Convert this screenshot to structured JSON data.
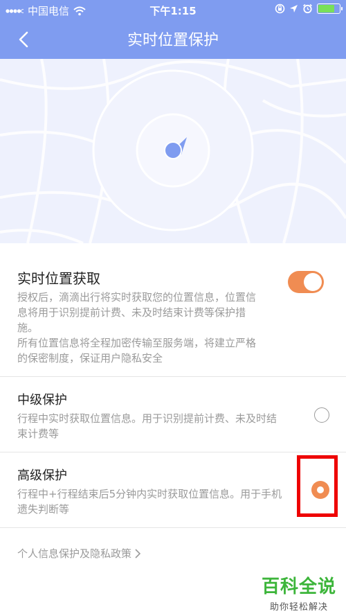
{
  "status_bar": {
    "carrier": "中国电信",
    "time": "下午1:15",
    "battery_level": 0.8,
    "icons": [
      "signal-icon",
      "wifi-icon",
      "rotation-lock-icon",
      "location-arrow-icon",
      "alarm-icon",
      "battery-icon"
    ]
  },
  "nav": {
    "title": "实时位置保护",
    "back_icon": "chevron-left-icon"
  },
  "realtime_location": {
    "title": "实时位置获取",
    "desc_lines": [
      "授权后，滴滴出行将实时获取您的位置信息，位置信",
      "息将用于识别提前计费、未及时结束计费等保护措",
      "施。",
      "所有位置信息将全程加密传输至服务端，将建立严格",
      "的保密制度，保证用户隐私安全"
    ],
    "toggle_on": true
  },
  "mid_protection": {
    "title": "中级保护",
    "desc_lines": [
      "行程中实时获取位置信息。用于识别提前计费、未及时结",
      "束计费等"
    ],
    "selected": false
  },
  "high_protection": {
    "title": "高级保护",
    "desc_lines": [
      "行程中+行程结束后5分钟内实时获取位置信息。用于手机",
      "遗失判断等"
    ],
    "selected": true
  },
  "policy_link": "个人信息保护及隐私政策",
  "watermark": {
    "brand": "百科全说",
    "slogan": "助你轻松解决"
  },
  "colors": {
    "header": "#7f9cf0",
    "accent": "#f08c52",
    "highlight": "#ee0000",
    "watermark_green": "#3cb53a"
  }
}
